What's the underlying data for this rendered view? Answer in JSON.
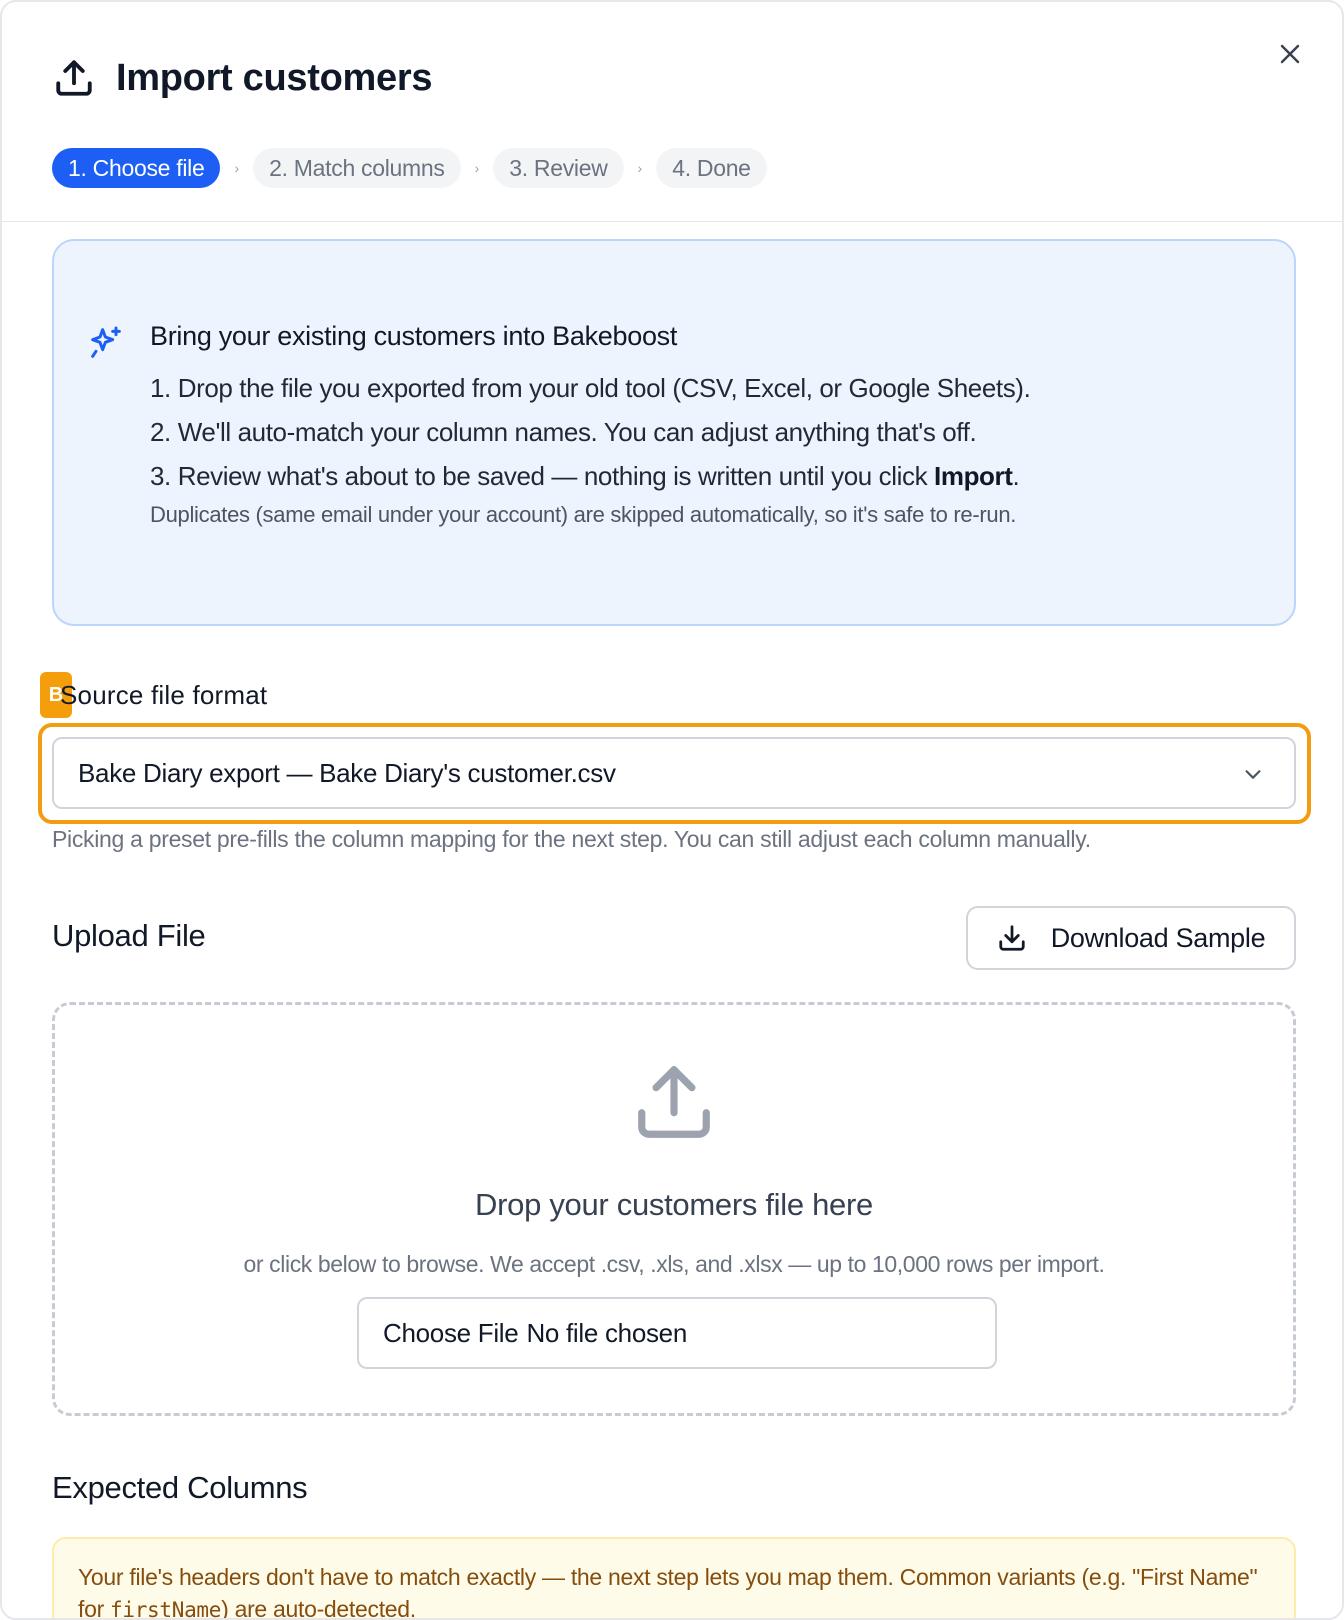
{
  "modal": {
    "title": "Import customers",
    "steps": [
      "1. Choose file",
      "2. Match columns",
      "3. Review",
      "4. Done"
    ]
  },
  "info": {
    "title": "Bring your existing customers into Bakeboost",
    "line1": "1. Drop the file you exported from your old tool (CSV, Excel, or Google Sheets).",
    "line2": "2. We'll auto-match your column names. You can adjust anything that's off.",
    "line3_prefix": "3. Review what's about to be saved — nothing is written until you click ",
    "line3_bold": "Import",
    "line3_suffix": ".",
    "note": "Duplicates (same email under your account) are skipped automatically, so it's safe to re-run."
  },
  "source": {
    "badge": "B",
    "label": "Source file format",
    "selected": "Bake Diary export — Bake Diary's customer.csv",
    "hint": "Picking a preset pre-fills the column mapping for the next step. You can still adjust each column manually."
  },
  "upload": {
    "title": "Upload File",
    "download_label": "Download Sample",
    "drop_title": "Drop your customers file here",
    "drop_sub": "or click below to browse. We accept .csv, .xls, and .xlsx — up to 10,000 rows per import.",
    "choose_label": "Choose File",
    "no_file": "No file chosen"
  },
  "expected": {
    "title": "Expected Columns",
    "note_prefix": "Your file's headers don't have to match exactly — the next step lets you map them. Common variants (e.g. \"First Name\" for ",
    "note_code": "firstName",
    "note_suffix": ") are auto-detected."
  },
  "colors": {
    "accent": "#1d5ff5",
    "highlight": "#f39c12",
    "info_bg": "#eef4fe",
    "note_bg": "#fefbe8"
  },
  "icons": [
    "upload-icon",
    "close-icon",
    "sparkle-icon",
    "chevron-down-icon",
    "download-icon"
  ]
}
